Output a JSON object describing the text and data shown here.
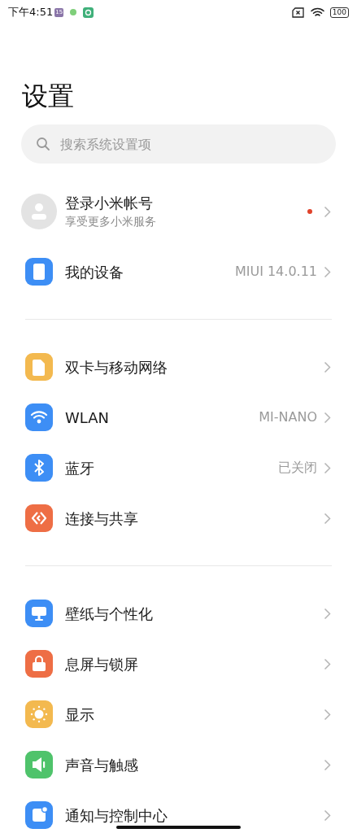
{
  "status_bar": {
    "time": "下午4:51",
    "calendar_badge": "15",
    "battery": "100"
  },
  "title": "设置",
  "search": {
    "placeholder": "搜索系统设置项"
  },
  "account": {
    "title": "登录小米帐号",
    "subtitle": "享受更多小米服务",
    "notification_dot": true
  },
  "groups": [
    [
      {
        "color": "#3d8ef5",
        "label": "我的设备",
        "value": "MIUI 14.0.11"
      }
    ],
    [
      {
        "color": "#f3b94f",
        "label": "双卡与移动网络"
      },
      {
        "color": "#3d8ef5",
        "label": "WLAN",
        "value": "MI-NANO"
      },
      {
        "color": "#3d8ef5",
        "label": "蓝牙",
        "value": "已关闭"
      },
      {
        "color": "#ee6e45",
        "label": "连接与共享"
      }
    ],
    [
      {
        "color": "#3d8ef5",
        "label": "壁纸与个性化"
      },
      {
        "color": "#ee6e45",
        "label": "息屏与锁屏"
      },
      {
        "color": "#f3b94f",
        "label": "显示"
      },
      {
        "color": "#4fc36b",
        "label": "声音与触感"
      },
      {
        "color": "#3d8ef5",
        "label": "通知与控制中心"
      }
    ]
  ]
}
